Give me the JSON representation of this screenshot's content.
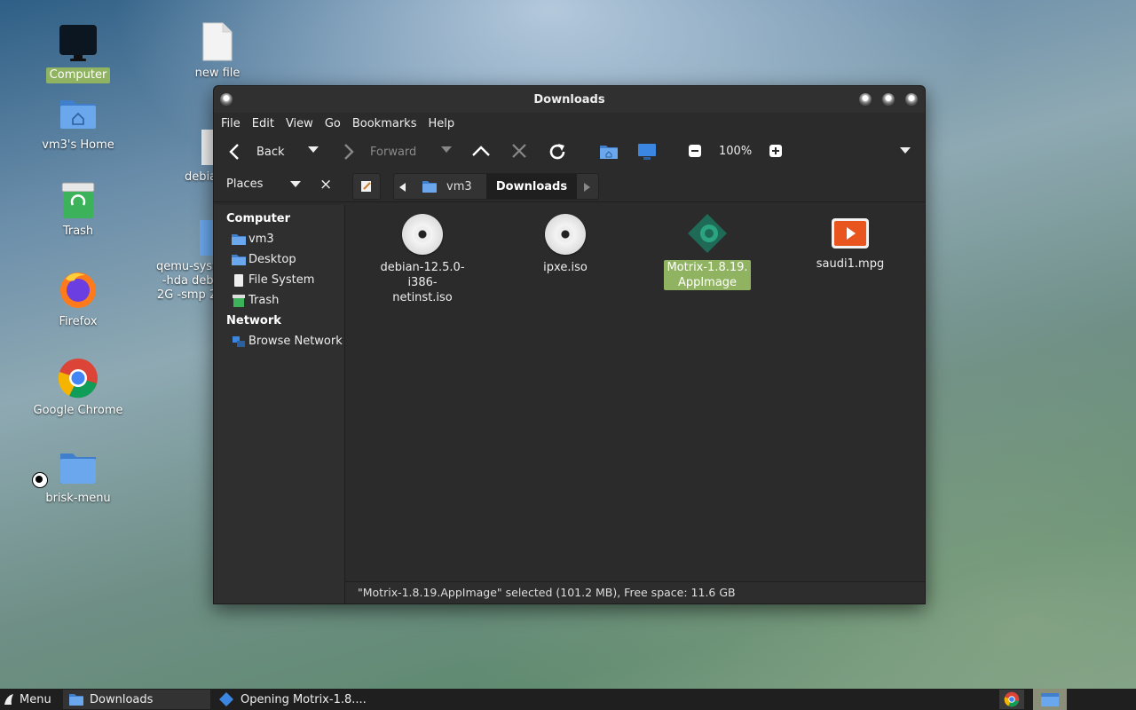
{
  "desktop": {
    "icons": [
      {
        "label": "Computer"
      },
      {
        "label": "vm3's Home"
      },
      {
        "label": "Trash"
      },
      {
        "label": "Firefox"
      },
      {
        "label": "Google Chrome"
      },
      {
        "label": "brisk-menu"
      },
      {
        "label": "new file"
      }
    ],
    "partial_labels": {
      "debian": "debia",
      "qemu": "qemu-syst\n-hda debi\n2G -smp 2"
    }
  },
  "window": {
    "title": "Downloads",
    "menu": [
      "File",
      "Edit",
      "View",
      "Go",
      "Bookmarks",
      "Help"
    ],
    "toolbar": {
      "back": "Back",
      "forward": "Forward",
      "zoom": "100%"
    },
    "places": {
      "label": "Places",
      "close": "×",
      "computer_heading": "Computer",
      "computer_items": [
        "vm3",
        "Desktop",
        "File System",
        "Trash"
      ],
      "network_heading": "Network",
      "network_items": [
        "Browse Network"
      ]
    },
    "path": [
      "vm3",
      "Downloads"
    ],
    "files": [
      {
        "name": "debian-12.5.0-i386-netinst.iso",
        "line1": "debian-12.5.0-i386-",
        "line2": "netinst.iso",
        "icon": "disc-icon"
      },
      {
        "name": "ipxe.iso",
        "line1": "ipxe.iso",
        "line2": "",
        "icon": "disc-icon"
      },
      {
        "name": "Motrix-1.8.19.AppImage",
        "line1": "Motrix-1.8.19.",
        "line2": "AppImage",
        "icon": "appimage-icon",
        "selected": true
      },
      {
        "name": "saudi1.mpg",
        "line1": "saudi1.mpg",
        "line2": "",
        "icon": "video-icon"
      }
    ],
    "status": "\"Motrix-1.8.19.AppImage\" selected (101.2 MB), Free space: 11.6 GB"
  },
  "taskbar": {
    "menu": "Menu",
    "tasks": [
      "Downloads",
      "Opening Motrix-1.8...."
    ]
  },
  "colors": {
    "selection": "#8fb360",
    "window_bg": "#2b2b2b",
    "folder_blue": "#5b9be0"
  }
}
